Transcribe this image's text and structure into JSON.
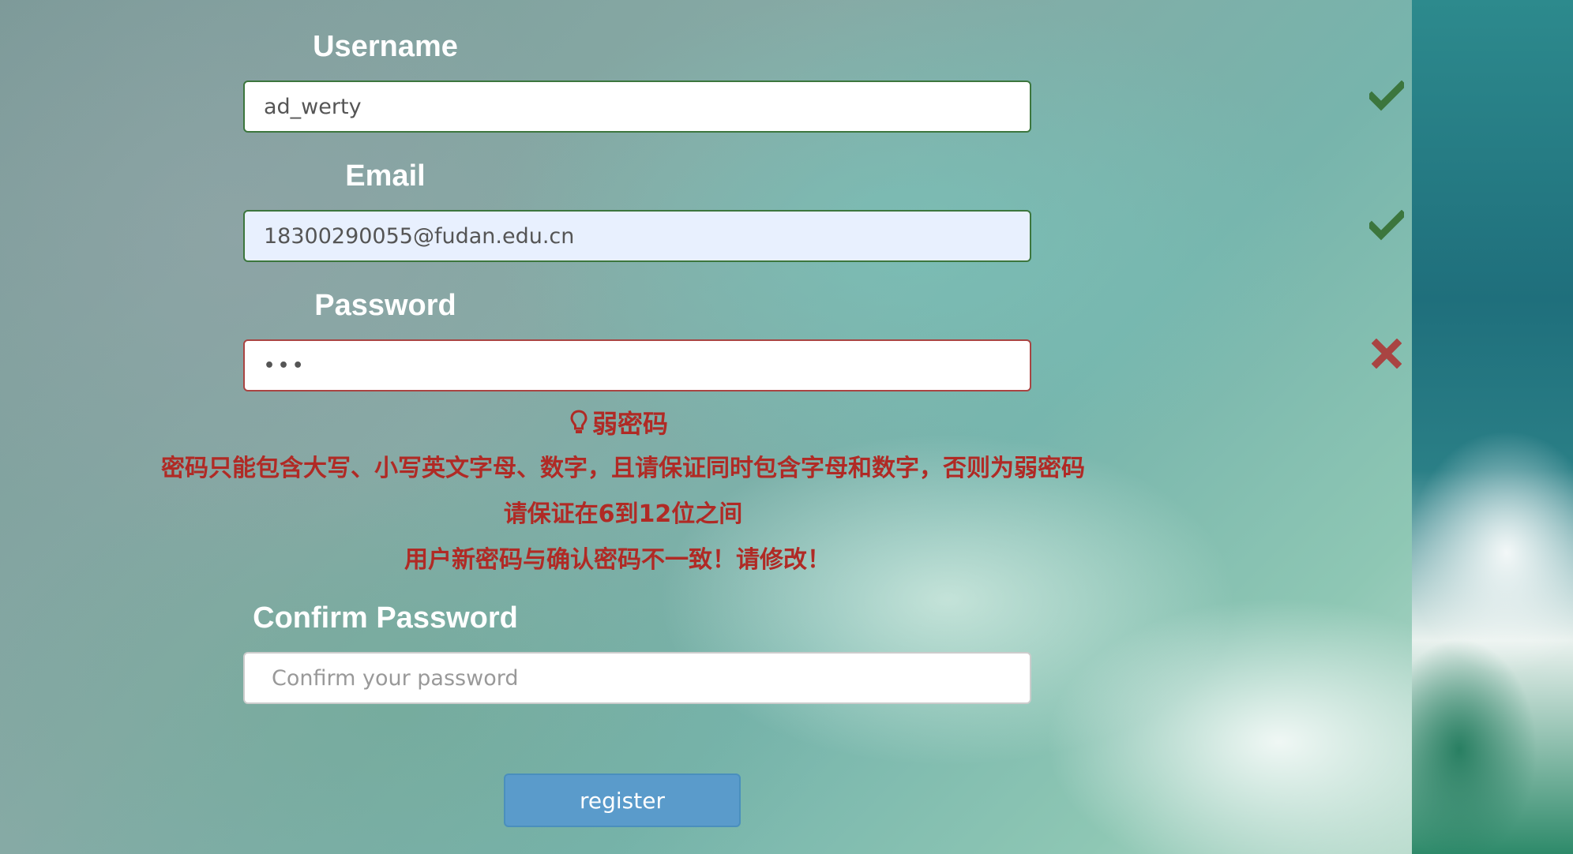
{
  "form": {
    "username": {
      "label": "Username",
      "value": "ad_werty",
      "status": "valid"
    },
    "email": {
      "label": "Email",
      "value": "18300290055@fudan.edu.cn",
      "status": "valid"
    },
    "password": {
      "label": "Password",
      "value": "•••",
      "status": "invalid"
    },
    "password_strength": "弱密码",
    "password_errors": [
      "密码只能包含大写、小写英文字母、数字，且请保证同时包含字母和数字，否则为弱密码",
      "请保证在6到12位之间",
      "用户新密码与确认密码不一致！请修改！"
    ],
    "confirm_password": {
      "label": "Confirm Password",
      "value": "",
      "placeholder": "Confirm your password"
    },
    "register_label": "register"
  },
  "colors": {
    "valid": "#3c763d",
    "invalid": "#a94442",
    "error_text": "#b02a25",
    "button": "#5a9bcb"
  },
  "icons": {
    "valid": "check-icon",
    "invalid": "cross-icon",
    "hint": "lightbulb-icon"
  }
}
